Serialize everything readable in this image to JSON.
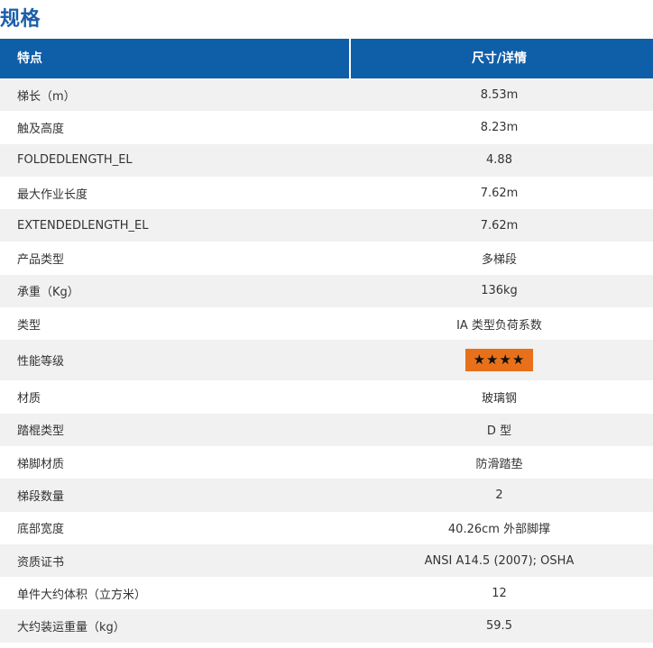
{
  "page": {
    "title": "规格"
  },
  "table": {
    "header": {
      "feature": "特点",
      "detail": "尺寸/详情"
    },
    "rows": [
      {
        "label": "梯长（m）",
        "value": "8.53m"
      },
      {
        "label": "触及高度",
        "value": "8.23m"
      },
      {
        "label": "FOLDEDLENGTH_EL",
        "value": "4.88"
      },
      {
        "label": "最大作业长度",
        "value": "7.62m"
      },
      {
        "label": "EXTENDEDLENGTH_EL",
        "value": "7.62m"
      },
      {
        "label": "产品类型",
        "value": "多梯段"
      },
      {
        "label": "承重（Kg）",
        "value": "136kg"
      },
      {
        "label": "类型",
        "value": "IA 类型负荷系数"
      },
      {
        "label": "性能等级",
        "value": "★★★★",
        "rating": 4
      },
      {
        "label": "材质",
        "value": "玻璃钢"
      },
      {
        "label": "踏棍类型",
        "value": "D 型"
      },
      {
        "label": "梯脚材质",
        "value": "防滑踏垫"
      },
      {
        "label": "梯段数量",
        "value": "2"
      },
      {
        "label": "底部宽度",
        "value": "40.26cm 外部脚撑"
      },
      {
        "label": "资质证书",
        "value": "ANSI A14.5 (2007); OSHA"
      },
      {
        "label": "单件大约体积（立方米）",
        "value": "12"
      },
      {
        "label": "大约装运重量（kg）",
        "value": "59.5"
      }
    ]
  },
  "colors": {
    "title": "#1c5eab",
    "header_bg": "#0f5ea8",
    "stripe": "#f1f1f1",
    "rating_badge": "#e8701a"
  }
}
